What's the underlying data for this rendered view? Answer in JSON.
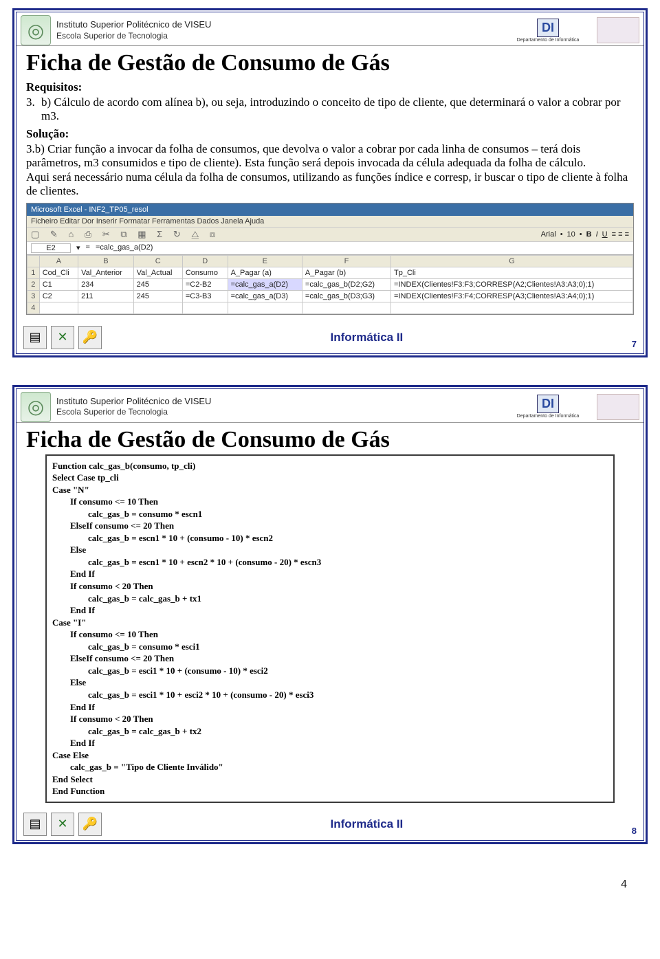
{
  "header": {
    "institution": "Instituto Superior Politécnico de VISEU",
    "school": "Escola Superior de Tecnologia",
    "dept_abbr": "DI",
    "dept_label": "Departamento de Informática"
  },
  "slide7": {
    "title": "Ficha de Gestão de Consumo de Gás",
    "requisitos_label": "Requisitos:",
    "item_num": "3.",
    "item_text": "b) Cálculo de acordo com alínea b), ou seja, introduzindo o conceito de tipo de cliente, que determinará o valor a cobrar por m3.",
    "solucao_label": "Solução:",
    "solucao_text": "3.b) Criar função a invocar da folha de consumos, que devolva o valor a cobrar por cada linha de consumos – terá dois parâmetros, m3 consumidos e tipo de cliente). Esta função será depois invocada da célula adequada da folha de cálculo.\nAqui será necessário numa célula da folha de consumos, utilizando as funções índice e corresp, ir buscar o tipo de cliente à folha de clientes.",
    "excel": {
      "titlebar": "Microsoft Excel - INF2_TP05_resol",
      "menubar": "Ficheiro  Editar  Dor  Inserir  Formatar  Ferramentas  Dados  Janela  Ajuda",
      "toolbar_glyphs": "▢ ✎ ⌂ ⎙ ✂ ⧉ ▦ Σ ↻ ⧋ ⧈",
      "font": "Arial",
      "size": "10",
      "cellref": "E2",
      "formula": "=calc_gas_a(D2)",
      "columns": [
        "",
        "A",
        "B",
        "C",
        "D",
        "E",
        "F",
        "G"
      ],
      "rows": [
        {
          "n": "1",
          "cells": [
            "Cod_Cli",
            "Val_Anterior",
            "Val_Actual",
            "Consumo",
            "A_Pagar (a)",
            "A_Pagar (b)",
            "Tp_Cli"
          ]
        },
        {
          "n": "2",
          "cells": [
            "C1",
            "234",
            "245",
            "=C2-B2",
            "=calc_gas_a(D2)",
            "=calc_gas_b(D2;G2)",
            "=INDEX(Clientes!F3:F3;CORRESP(A2;Clientes!A3:A3;0);1)"
          ]
        },
        {
          "n": "3",
          "cells": [
            "C2",
            "211",
            "245",
            "=C3-B3",
            "=calc_gas_a(D3)",
            "=calc_gas_b(D3;G3)",
            "=INDEX(Clientes!F3:F4;CORRESP(A3;Clientes!A3:A4;0);1)"
          ]
        },
        {
          "n": "4",
          "cells": [
            "",
            "",
            "",
            "",
            "",
            "",
            ""
          ]
        }
      ]
    },
    "footer_label": "Informática II",
    "slide_number": "7"
  },
  "slide8": {
    "title": "Ficha de Gestão de Consumo de Gás",
    "code": "Function calc_gas_b(consumo, tp_cli)\nSelect Case tp_cli\nCase \"N\"\n        If consumo <= 10 Then\n                calc_gas_b = consumo * escn1\n        ElseIf consumo <= 20 Then\n                calc_gas_b = escn1 * 10 + (consumo - 10) * escn2\n        Else\n                calc_gas_b = escn1 * 10 + escn2 * 10 + (consumo - 20) * escn3\n        End If\n        If consumo < 20 Then\n                calc_gas_b = calc_gas_b + tx1\n        End If\nCase \"I\"\n        If consumo <= 10 Then\n                calc_gas_b = consumo * esci1\n        ElseIf consumo <= 20 Then\n                calc_gas_b = esci1 * 10 + (consumo - 10) * esci2\n        Else\n                calc_gas_b = esci1 * 10 + esci2 * 10 + (consumo - 20) * esci3\n        End If\n        If consumo < 20 Then\n                calc_gas_b = calc_gas_b + tx2\n        End If\nCase Else\n        calc_gas_b = \"Tipo de Cliente Inválido\"\nEnd Select\nEnd Function",
    "footer_label": "Informática II",
    "slide_number": "8"
  },
  "page_number": "4"
}
